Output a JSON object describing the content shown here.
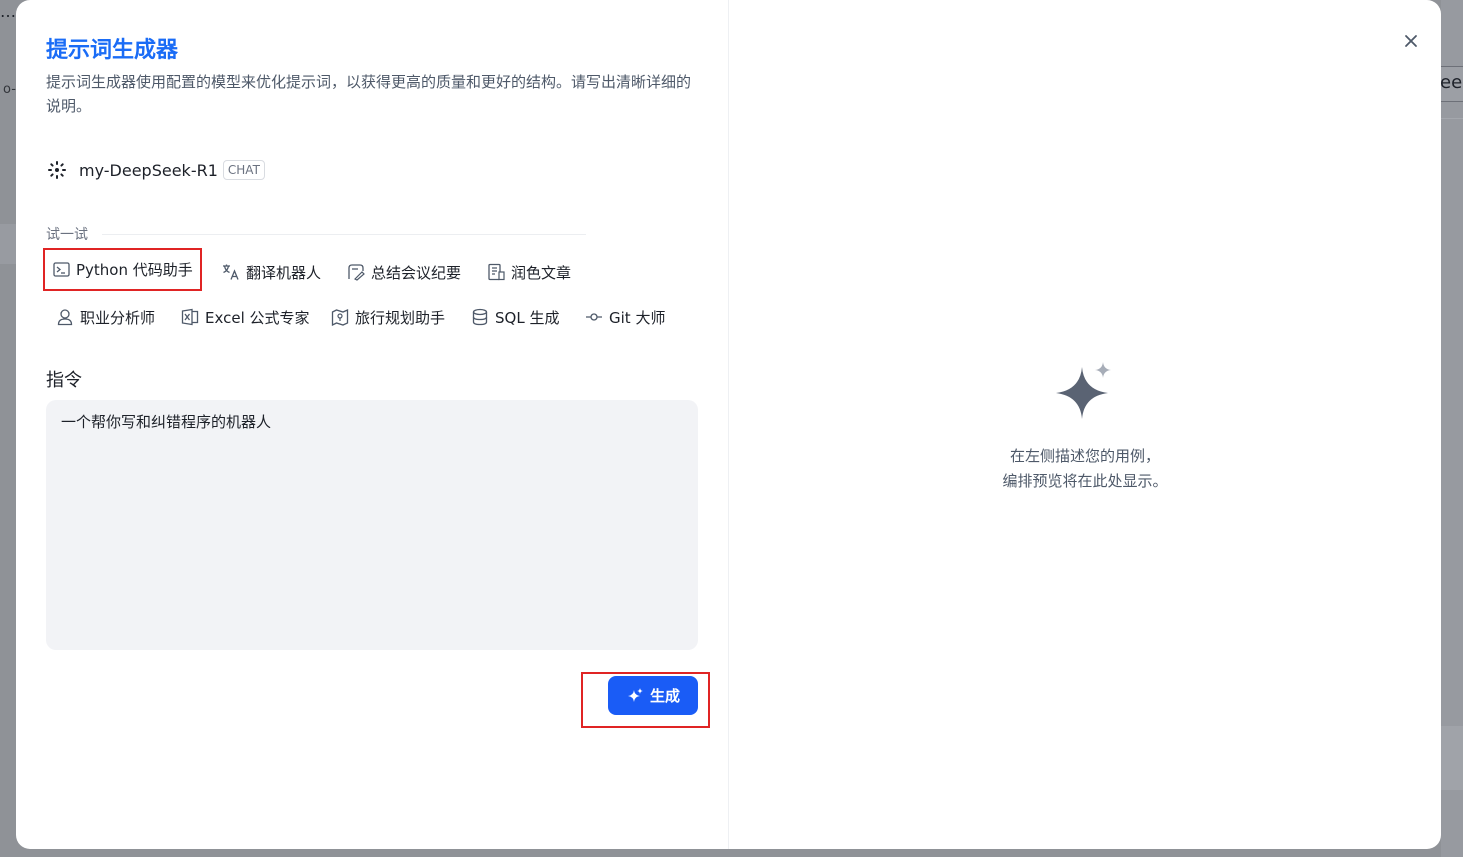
{
  "background": {
    "fragment_left_top": "…",
    "fragment_left_icon": "o-",
    "fragment_right": "eek"
  },
  "dialog": {
    "title": "提示词生成器",
    "description": "提示词生成器使用配置的模型来优化提示词，以获得更高的质量和更好的结构。请写出清晰详细的说明。",
    "model": {
      "icon": "model-provider-icon",
      "name": "my-DeepSeek-R1",
      "badge": "CHAT"
    },
    "try_label": "试一试",
    "suggestions": [
      {
        "label": "Python 代码助手",
        "icon": "terminal-icon"
      },
      {
        "label": "翻译机器人",
        "icon": "translate-icon"
      },
      {
        "label": "总结会议纪要",
        "icon": "meeting-summary-icon"
      },
      {
        "label": "润色文章",
        "icon": "document-edit-icon"
      },
      {
        "label": "职业分析师",
        "icon": "user-icon"
      },
      {
        "label": "Excel 公式专家",
        "icon": "excel-icon"
      },
      {
        "label": "旅行规划助手",
        "icon": "map-icon"
      },
      {
        "label": "SQL 生成",
        "icon": "database-icon"
      },
      {
        "label": "Git 大师",
        "icon": "git-commit-icon"
      }
    ],
    "instruction_label": "指令",
    "instruction_value": "一个帮你写和纠错程序的机器人",
    "generate_button": "生成",
    "close_icon": "close-icon"
  },
  "preview": {
    "icon": "sparkle-icon",
    "empty_line1": "在左侧描述您的用例，",
    "empty_line2": "编排预览将在此处显示。"
  },
  "colors": {
    "accent": "#1a6cf6",
    "button": "#1a5cf6",
    "highlight_outline": "#e02424",
    "input_bg": "#f2f3f6",
    "muted_text": "#4e5969",
    "sparkle": "#5a6373"
  }
}
